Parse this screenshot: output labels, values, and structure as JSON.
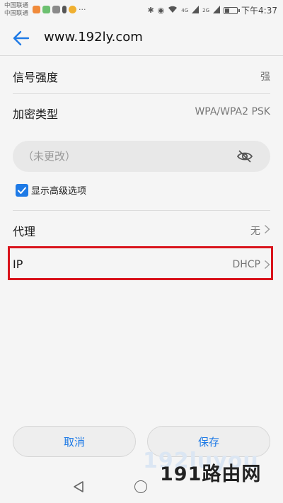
{
  "status": {
    "carrier1": "中国联通",
    "carrier2": "中国联通",
    "network1": "4G",
    "network2": "2G",
    "time": "下午4:37",
    "battery_level": 0.35
  },
  "header": {
    "title": "www.192ly.com",
    "back_icon": "arrow-left-icon"
  },
  "rows": {
    "signal": {
      "label": "信号强度",
      "value": "强"
    },
    "encryption": {
      "label": "加密类型",
      "value": "WPA/WPA2 PSK"
    },
    "proxy": {
      "label": "代理",
      "value": "无"
    },
    "ip": {
      "label": "IP",
      "value": "DHCP"
    }
  },
  "password": {
    "placeholder": "（未更改）",
    "value": ""
  },
  "advanced": {
    "label": "显示高级选项",
    "checked": true
  },
  "buttons": {
    "cancel": "取消",
    "save": "保存"
  },
  "watermark": {
    "faint": "192luyou",
    "main": "191路由网"
  },
  "colors": {
    "accent": "#1e7ae6",
    "highlight": "#d9141c",
    "background": "#f5f5f5"
  }
}
